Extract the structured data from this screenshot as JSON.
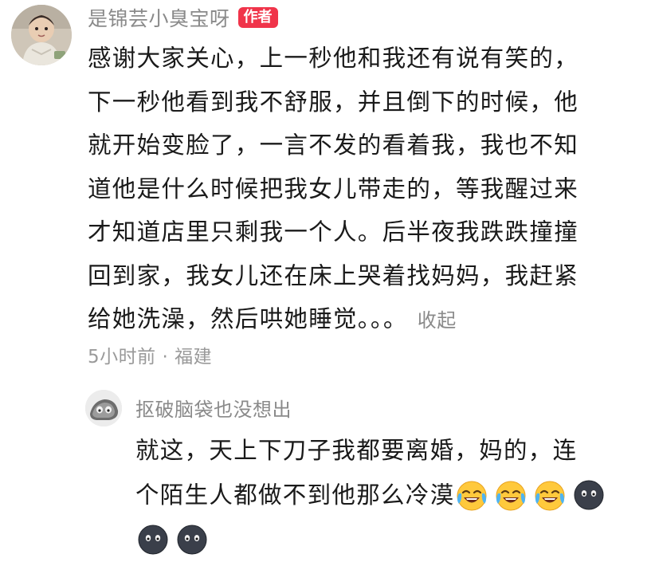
{
  "main_comment": {
    "author": "是锦芸小臭宝呀",
    "badge": "作者",
    "lines": [
      "感谢大家关心，上一秒他和我还有说有笑的，",
      "下一秒他看到我不舒服，并且倒下的时候，他",
      "就开始变脸了，一言不发的看着我，我也不知",
      "道他是什么时候把我女儿带走的，等我醒过来",
      "才知道店里只剩我一个人。后半夜我跌跌撞撞",
      "回到家，我女儿还在床上哭着找妈妈，我赶紧",
      "给她洗澡，然后哄她睡觉。。。"
    ],
    "collapse_label": "收起",
    "meta": "5小时前 · 福建"
  },
  "reply": {
    "author": "抠破脑袋也没想出",
    "line1": "就这，天上下刀子我都要离婚，妈的，连",
    "line2": "个陌生人都做不到他那么冷漠",
    "emoji_row2": [
      "crying-laughing-emoji",
      "crying-laughing-emoji",
      "crying-laughing-emoji",
      "dark-face-emoji"
    ],
    "emoji_row3": [
      "dark-face-emoji",
      "dark-face-emoji"
    ]
  },
  "colors": {
    "badge": "#f0344a",
    "username": "#8a8a8a",
    "meta": "#9a9a9a",
    "body_text": "#1a1a1a"
  }
}
